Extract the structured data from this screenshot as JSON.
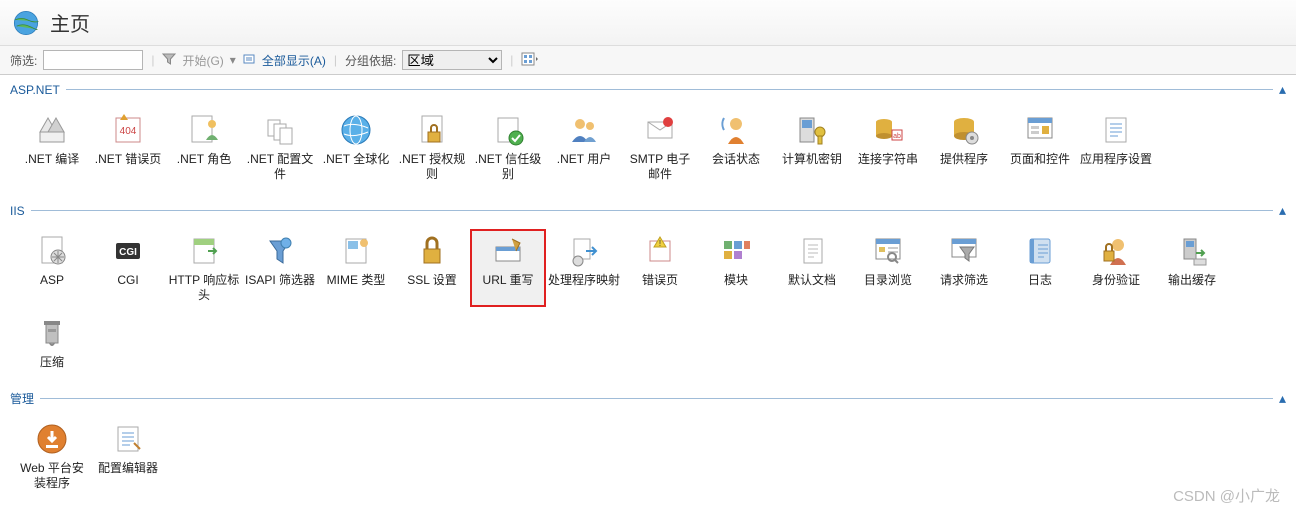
{
  "header": {
    "title": "主页"
  },
  "toolbar": {
    "filter_label": "筛选:",
    "filter_value": "",
    "start_label": "开始(G)",
    "show_all_label": "全部显示(A)",
    "group_by_label": "分组依据:",
    "group_by_value": "区域"
  },
  "groups": {
    "aspnet": {
      "title": "ASP.NET",
      "items": [
        ".NET 编译",
        ".NET 错误页",
        ".NET 角色",
        ".NET 配置文件",
        ".NET 全球化",
        ".NET 授权规则",
        ".NET 信任级别",
        ".NET 用户",
        "SMTP 电子邮件",
        "会话状态",
        "计算机密钥",
        "连接字符串",
        "提供程序",
        "页面和控件",
        "应用程序设置"
      ]
    },
    "iis": {
      "title": "IIS",
      "items": [
        "ASP",
        "CGI",
        "HTTP 响应标头",
        "ISAPI 筛选器",
        "MIME 类型",
        "SSL 设置",
        "URL 重写",
        "处理程序映射",
        "错误页",
        "模块",
        "默认文档",
        "目录浏览",
        "请求筛选",
        "日志",
        "身份验证",
        "输出缓存",
        "压缩"
      ],
      "highlighted_index": 6
    },
    "management": {
      "title": "管理",
      "items": [
        "Web 平台安装程序",
        "配置编辑器"
      ]
    }
  },
  "watermark": "CSDN @小广龙"
}
